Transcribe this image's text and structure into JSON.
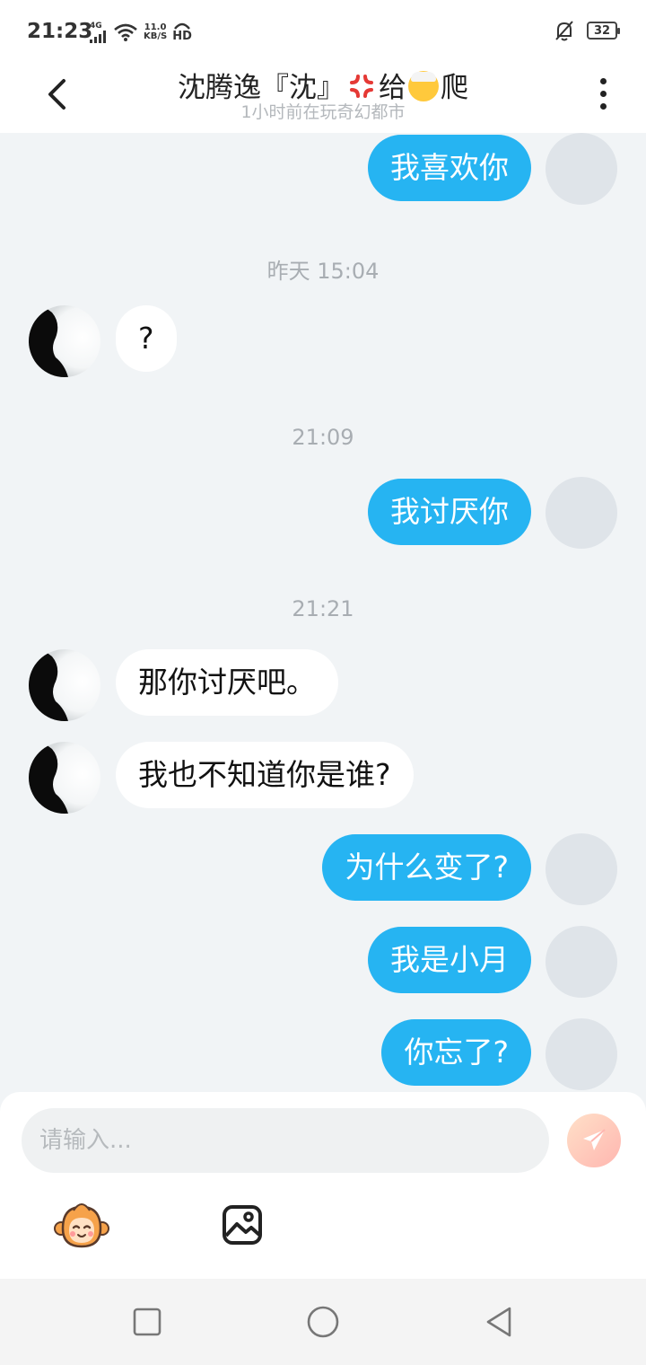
{
  "status_bar": {
    "time": "21:23",
    "network": "4G",
    "speed_value": "11.0",
    "speed_unit": "KB/S",
    "hd": "HD",
    "battery": "32"
  },
  "header": {
    "title_part1": "沈腾逸『沈』",
    "title_part2": "给",
    "title_part3": "爬",
    "subtitle": "1小时前在玩奇幻都市",
    "back_icon": "chevron-left-icon",
    "more_icon": "more-vertical-icon"
  },
  "messages": {
    "m1": "我喜欢你",
    "ts1": "昨天 15:04",
    "m2": "?",
    "ts2": "21:09",
    "m3": "我讨厌你",
    "ts3": "21:21",
    "m4": "那你讨厌吧。",
    "m5": "我也不知道你是谁?",
    "m6": "为什么变了?",
    "m7": "我是小月",
    "m8": "你忘了?"
  },
  "input": {
    "placeholder": "请输入...",
    "send_icon": "paper-plane-icon",
    "mascot_icon": "monkey-mascot-icon",
    "image_icon": "image-icon"
  },
  "nav": {
    "recents_icon": "square-icon",
    "home_icon": "circle-icon",
    "back_icon": "triangle-back-icon"
  },
  "colors": {
    "outgoing_bubble": "#26b4f2",
    "incoming_bubble": "#ffffff",
    "chat_background": "#f1f4f6",
    "send_button": "#ffb6b0"
  }
}
